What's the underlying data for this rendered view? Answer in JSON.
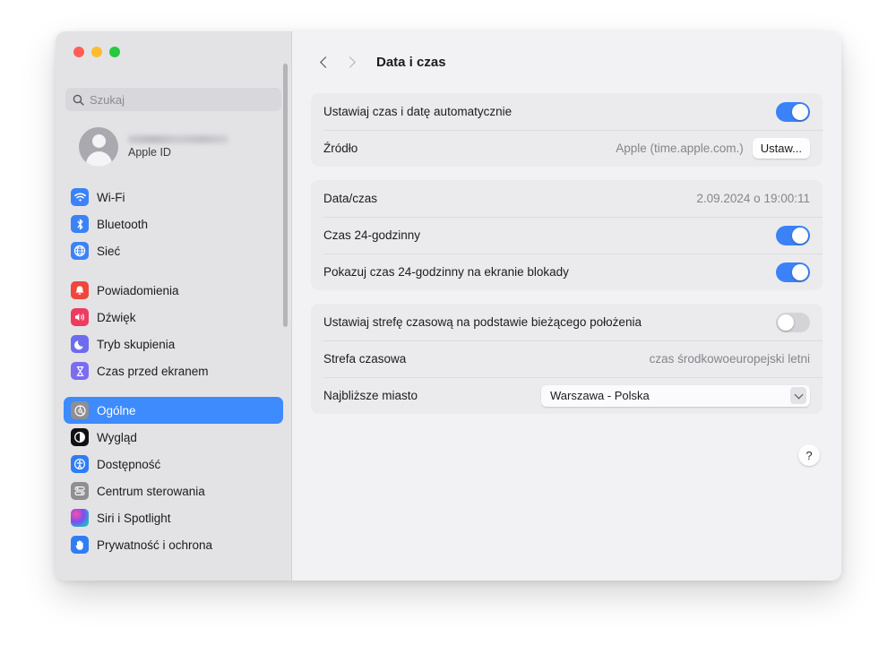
{
  "window": {
    "traffic_lights": [
      {
        "name": "close",
        "color": "#ff5f57"
      },
      {
        "name": "minimize",
        "color": "#febc2e"
      },
      {
        "name": "zoom",
        "color": "#28c840"
      }
    ]
  },
  "sidebar": {
    "search": {
      "placeholder": "Szukaj",
      "value": "",
      "icon": "search-icon"
    },
    "account": {
      "name_redacted": "",
      "subtitle": "Apple ID",
      "avatar": "person-avatar-icon"
    },
    "groups": [
      {
        "items": [
          {
            "label": "Wi-Fi",
            "icon": "wifi-icon",
            "icon_class": "ic-wifi",
            "selected": false
          },
          {
            "label": "Bluetooth",
            "icon": "bluetooth-icon",
            "icon_class": "ic-bluetooth",
            "selected": false
          },
          {
            "label": "Sieć",
            "icon": "globe-icon",
            "icon_class": "ic-network",
            "selected": false
          }
        ]
      },
      {
        "items": [
          {
            "label": "Powiadomienia",
            "icon": "bell-icon",
            "icon_class": "ic-notif",
            "selected": false
          },
          {
            "label": "Dźwięk",
            "icon": "speaker-icon",
            "icon_class": "ic-sound",
            "selected": false
          },
          {
            "label": "Tryb skupienia",
            "icon": "moon-icon",
            "icon_class": "ic-focus",
            "selected": false
          },
          {
            "label": "Czas przed ekranem",
            "icon": "hourglass-icon",
            "icon_class": "ic-screen",
            "selected": false
          }
        ]
      },
      {
        "items": [
          {
            "label": "Ogólne",
            "icon": "gear-icon",
            "icon_class": "ic-general",
            "selected": true
          },
          {
            "label": "Wygląd",
            "icon": "appearance-icon",
            "icon_class": "ic-appear",
            "selected": false
          },
          {
            "label": "Dostępność",
            "icon": "accessibility-icon",
            "icon_class": "ic-access",
            "selected": false
          },
          {
            "label": "Centrum sterowania",
            "icon": "control-center-icon",
            "icon_class": "ic-control",
            "selected": false
          },
          {
            "label": "Siri i Spotlight",
            "icon": "siri-icon",
            "icon_class": "ic-siri",
            "selected": false
          },
          {
            "label": "Prywatność i ochrona",
            "icon": "hand-icon",
            "icon_class": "ic-privacy",
            "selected": false
          }
        ]
      }
    ]
  },
  "toolbar": {
    "back_icon": "chevron-left-icon",
    "forward_icon": "chevron-right-icon",
    "title": "Data i czas"
  },
  "main": {
    "cards": [
      {
        "rows": [
          {
            "label": "Ustawiaj czas i datę automatycznie",
            "control": "toggle",
            "state": "on"
          },
          {
            "label": "Źródło",
            "value": "Apple (time.apple.com.)",
            "control": "button",
            "button_label": "Ustaw..."
          }
        ]
      },
      {
        "rows": [
          {
            "label": "Data/czas",
            "value": "2.09.2024 o 19:00:11",
            "control": "none"
          },
          {
            "label": "Czas 24-godzinny",
            "control": "toggle",
            "state": "on"
          },
          {
            "label": "Pokazuj czas 24-godzinny na ekranie blokady",
            "control": "toggle",
            "state": "on"
          }
        ]
      },
      {
        "rows": [
          {
            "label": "Ustawiaj strefę czasową na podstawie bieżącego położenia",
            "control": "toggle",
            "state": "off"
          },
          {
            "label": "Strefa czasowa",
            "value": "czas środkowoeuropejski letni",
            "control": "none"
          },
          {
            "label": "Najbliższe miasto",
            "control": "dropdown",
            "selected_option": "Warszawa - Polska"
          }
        ]
      }
    ],
    "help_button": {
      "label": "?",
      "icon": "question-mark-icon"
    }
  },
  "colors": {
    "accent": "#3b82f6",
    "selection": "#3d8bfd",
    "window_bg": "#f2f2f5",
    "sidebar_bg": "#e3e3e6",
    "card_bg": "#ebebee"
  }
}
